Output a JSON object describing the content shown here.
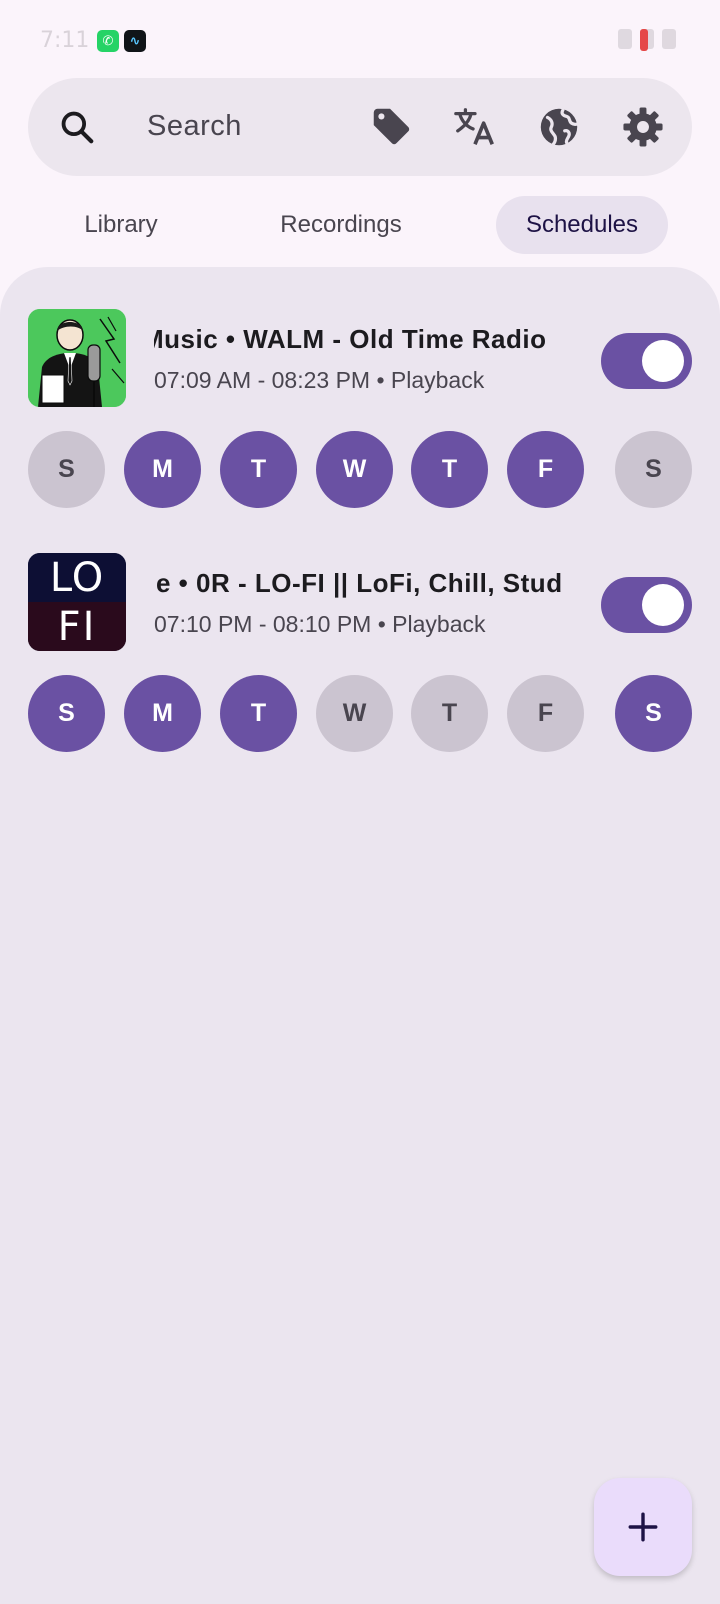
{
  "status_bar": {
    "time": "7:11",
    "apps": [
      "whatsapp-icon",
      "soundwave-app-icon"
    ]
  },
  "search": {
    "placeholder": "Search",
    "icons": [
      "search-icon",
      "tag-icon",
      "translate-icon",
      "globe-icon",
      "gear-icon"
    ]
  },
  "tabs": [
    {
      "label": "Library",
      "selected": false
    },
    {
      "label": "Recordings",
      "selected": false
    },
    {
      "label": "Schedules",
      "selected": true
    }
  ],
  "schedules": [
    {
      "title": "Music • WALM - Old Time Radio",
      "time": "07:09 AM - 08:23 PM • Playback",
      "enabled": true,
      "days": [
        {
          "label": "S",
          "active": false
        },
        {
          "label": "M",
          "active": true
        },
        {
          "label": "T",
          "active": true
        },
        {
          "label": "W",
          "active": true
        },
        {
          "label": "T",
          "active": true
        },
        {
          "label": "F",
          "active": true
        },
        {
          "label": "S",
          "active": false
        }
      ]
    },
    {
      "title": "e • 0R - LO-FI || LoFi, Chill, Stud",
      "time": "07:10 PM - 08:10 PM • Playback",
      "enabled": true,
      "artwork_text": [
        "LO",
        "FI"
      ],
      "days": [
        {
          "label": "S",
          "active": true
        },
        {
          "label": "M",
          "active": true
        },
        {
          "label": "T",
          "active": true
        },
        {
          "label": "W",
          "active": false
        },
        {
          "label": "T",
          "active": false
        },
        {
          "label": "F",
          "active": false
        },
        {
          "label": "S",
          "active": true
        }
      ]
    }
  ],
  "fab": {
    "icon": "plus-icon"
  },
  "colors": {
    "accent": "#6a51a3",
    "day_inactive": "#cbc4d0",
    "panel": "#ebe5ef",
    "fab": "#eadcfb"
  }
}
